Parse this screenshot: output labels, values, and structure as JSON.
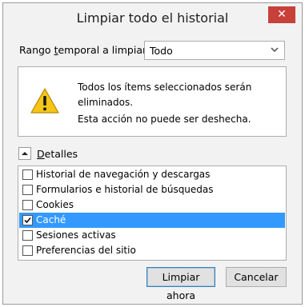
{
  "window": {
    "title": "Limpiar todo el historial",
    "close_glyph": "✕"
  },
  "range": {
    "label": "Rango temporal a limpiar:",
    "value": "Todo"
  },
  "warning": {
    "icon": "warning-icon",
    "line1": "Todos los ítems seleccionados serán eliminados.",
    "line2": "Esta acción no puede ser deshecha."
  },
  "details": {
    "label": "Detalles",
    "expanded": true
  },
  "items": [
    {
      "label": "Historial de navegación y descargas",
      "checked": false,
      "selected": false
    },
    {
      "label": "Formularios e historial de búsquedas",
      "checked": false,
      "selected": false
    },
    {
      "label": "Cookies",
      "checked": false,
      "selected": false
    },
    {
      "label": "Caché",
      "checked": true,
      "selected": true
    },
    {
      "label": "Sesiones activas",
      "checked": false,
      "selected": false
    },
    {
      "label": "Preferencias del sitio",
      "checked": false,
      "selected": false
    }
  ],
  "buttons": {
    "clear_now": "Limpiar ahora",
    "cancel": "Cancelar"
  },
  "colors": {
    "accent": "#3399ff",
    "close": "#c7403a",
    "warning": "#f5c518"
  }
}
